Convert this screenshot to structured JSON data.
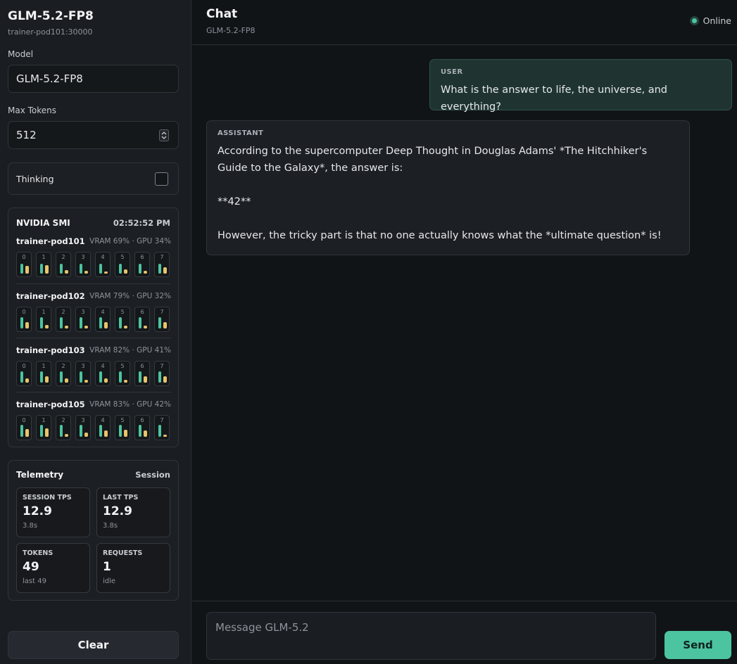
{
  "sidebar": {
    "title": "GLM-5.2-FP8",
    "endpoint": "trainer-pod101:30000",
    "model_label": "Model",
    "model_value": "GLM-5.2-FP8",
    "max_tokens_label": "Max Tokens",
    "max_tokens_value": "512",
    "thinking_label": "Thinking",
    "thinking_checked": false,
    "clear_label": "Clear"
  },
  "smi": {
    "title": "NVIDIA SMI",
    "time": "02:52:52 PM",
    "pods": [
      {
        "name": "trainer-pod101",
        "stats": "VRAM 69% · GPU 34%",
        "gpus": [
          {
            "idx": "0",
            "vram": 0.69,
            "util": 0.55
          },
          {
            "idx": "1",
            "vram": 0.69,
            "util": 0.6
          },
          {
            "idx": "2",
            "vram": 0.69,
            "util": 0.25
          },
          {
            "idx": "3",
            "vram": 0.69,
            "util": 0.2
          },
          {
            "idx": "4",
            "vram": 0.69,
            "util": 0.15
          },
          {
            "idx": "5",
            "vram": 0.69,
            "util": 0.3
          },
          {
            "idx": "6",
            "vram": 0.69,
            "util": 0.2
          },
          {
            "idx": "7",
            "vram": 0.69,
            "util": 0.45
          }
        ]
      },
      {
        "name": "trainer-pod102",
        "stats": "VRAM 79% · GPU 32%",
        "gpus": [
          {
            "idx": "0",
            "vram": 0.79,
            "util": 0.45
          },
          {
            "idx": "1",
            "vram": 0.79,
            "util": 0.25
          },
          {
            "idx": "2",
            "vram": 0.79,
            "util": 0.2
          },
          {
            "idx": "3",
            "vram": 0.79,
            "util": 0.2
          },
          {
            "idx": "4",
            "vram": 0.79,
            "util": 0.45
          },
          {
            "idx": "5",
            "vram": 0.79,
            "util": 0.2
          },
          {
            "idx": "6",
            "vram": 0.79,
            "util": 0.2
          },
          {
            "idx": "7",
            "vram": 0.79,
            "util": 0.45
          }
        ]
      },
      {
        "name": "trainer-pod103",
        "stats": "VRAM 82% · GPU 41%",
        "gpus": [
          {
            "idx": "0",
            "vram": 0.82,
            "util": 0.3
          },
          {
            "idx": "1",
            "vram": 0.82,
            "util": 0.45
          },
          {
            "idx": "2",
            "vram": 0.82,
            "util": 0.3
          },
          {
            "idx": "3",
            "vram": 0.82,
            "util": 0.2
          },
          {
            "idx": "4",
            "vram": 0.82,
            "util": 0.3
          },
          {
            "idx": "5",
            "vram": 0.82,
            "util": 0.2
          },
          {
            "idx": "6",
            "vram": 0.82,
            "util": 0.45
          },
          {
            "idx": "7",
            "vram": 0.82,
            "util": 0.45
          }
        ]
      },
      {
        "name": "trainer-pod105",
        "stats": "VRAM 83% · GPU 42%",
        "gpus": [
          {
            "idx": "0",
            "vram": 0.83,
            "util": 0.55
          },
          {
            "idx": "1",
            "vram": 0.83,
            "util": 0.6
          },
          {
            "idx": "2",
            "vram": 0.83,
            "util": 0.2
          },
          {
            "idx": "3",
            "vram": 0.83,
            "util": 0.3
          },
          {
            "idx": "4",
            "vram": 0.83,
            "util": 0.45
          },
          {
            "idx": "5",
            "vram": 0.83,
            "util": 0.5
          },
          {
            "idx": "6",
            "vram": 0.83,
            "util": 0.45
          },
          {
            "idx": "7",
            "vram": 0.83,
            "util": 0.15
          }
        ]
      }
    ],
    "vram_color": "#4cc4a0",
    "util_color": "#e8c46a"
  },
  "telemetry": {
    "title": "Telemetry",
    "scope": "Session",
    "tiles": [
      {
        "label": "SESSION TPS",
        "value": "12.9",
        "sub": "3.8s"
      },
      {
        "label": "LAST TPS",
        "value": "12.9",
        "sub": "3.8s"
      },
      {
        "label": "TOKENS",
        "value": "49",
        "sub": "last 49"
      },
      {
        "label": "REQUESTS",
        "value": "1",
        "sub": "idle"
      }
    ]
  },
  "header": {
    "title": "Chat",
    "subtitle": "GLM-5.2-FP8",
    "status": "Online",
    "status_color": "#4cc4a0"
  },
  "messages": [
    {
      "role": "USER",
      "text": "What is the answer to life, the universe, and everything?"
    },
    {
      "role": "ASSISTANT",
      "text": "According to the supercomputer Deep Thought in Douglas Adams' *The Hitchhiker's Guide to the Galaxy*, the answer is:\n\n**42**\n\nHowever, the tricky part is that no one actually knows what the *ultimate question* is!"
    }
  ],
  "composer": {
    "placeholder": "Message GLM-5.2",
    "send_label": "Send"
  },
  "icons": [
    "stepper-icon",
    "status-dot-icon"
  ]
}
